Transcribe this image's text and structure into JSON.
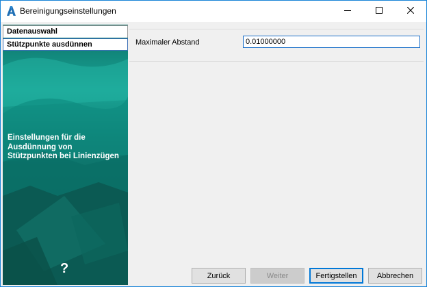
{
  "window": {
    "title": "Bereinigungseinstellungen"
  },
  "nav": {
    "items": [
      {
        "label": "Datenauswahl"
      },
      {
        "label": "Stützpunkte ausdünnen"
      }
    ],
    "description": "Einstellungen für die Ausdünnung von Stützpunkten bei Linienzügen",
    "help": "?"
  },
  "form": {
    "max_distance_label": "Maximaler Abstand",
    "max_distance_value": "0.01000000"
  },
  "buttons": {
    "back": "Zurück",
    "next": "Weiter",
    "finish": "Fertigstellen",
    "cancel": "Abbrechen"
  },
  "colors": {
    "accent": "#0078d7",
    "panel_teal": "#0a6b63"
  },
  "icons": {
    "app": "autodesk-a-icon",
    "minimize": "minimize-icon",
    "maximize": "maximize-icon",
    "close": "close-icon"
  }
}
